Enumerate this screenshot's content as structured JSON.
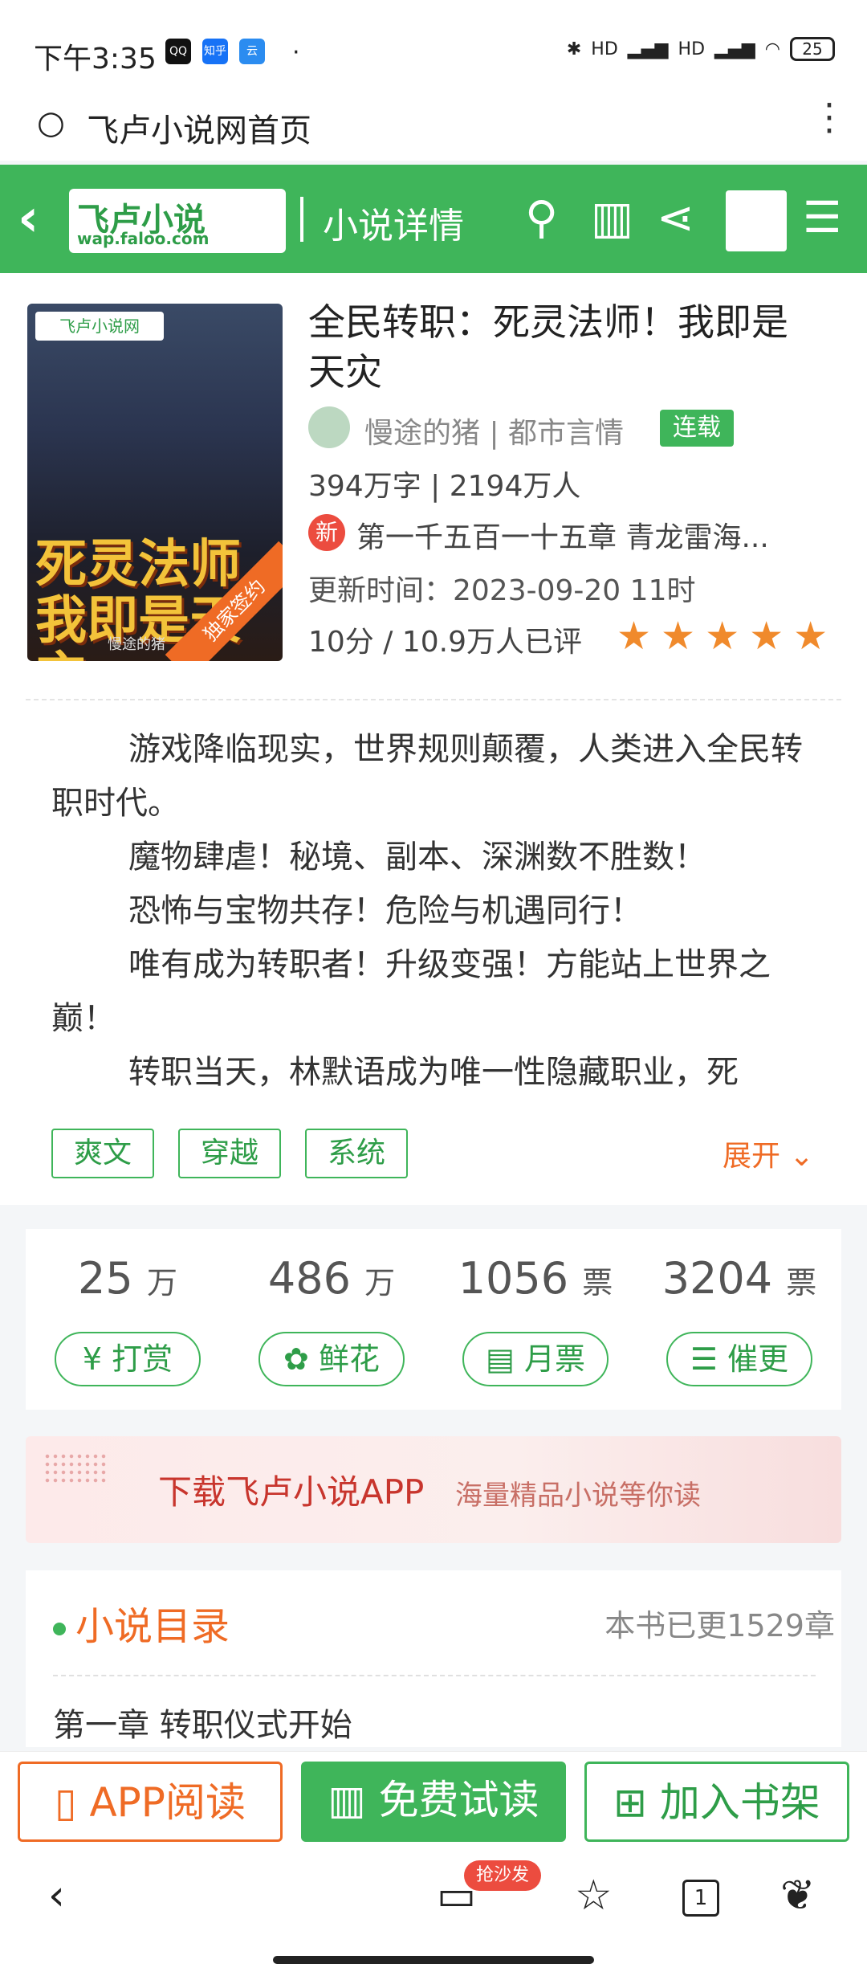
{
  "status": {
    "time": "下午3:35",
    "apps": [
      "QQ",
      "知乎",
      "云"
    ],
    "battery": "25",
    "signal_labels": [
      "HD",
      "HD"
    ]
  },
  "browser": {
    "url_title": "飞卢小说网首页"
  },
  "nav": {
    "logo_cn": "飞卢小说",
    "logo_url": "wap.faloo.com",
    "page_title": "小说详情"
  },
  "book": {
    "title": "全民转职：死灵法师！我即是天灾",
    "author": "慢途的猪",
    "category": "都市言情",
    "status_tag": "连载",
    "stats_line": "394万字 | 2194万人",
    "new_badge": "新",
    "latest_chapter": "第一千五百一十五章 青龙雷海...",
    "update_time": "更新时间：2023-09-20 11时",
    "rating": "10分 / 10.9万人已评",
    "stars": 5,
    "cover": {
      "site": "飞卢小说网",
      "big_text": "死灵法师 我即是天灾",
      "ribbon": "独家签约",
      "author": "慢途的猪"
    }
  },
  "description": [
    "游戏降临现实，世界规则颠覆，人类进入全民转职时代。",
    "魔物肆虐！秘境、副本、深渊数不胜数！",
    "恐怖与宝物共存！危险与机遇同行！",
    "唯有成为转职者！升级变强！方能站上世界之巅！",
    "转职当天，林默语成为唯一性隐藏职业，死"
  ],
  "tags": [
    "爽文",
    "穿越",
    "系统"
  ],
  "expand_label": "展开 ⌄",
  "stats": [
    {
      "num": "25",
      "unit": "万",
      "btn": "打赏"
    },
    {
      "num": "486",
      "unit": "万",
      "btn": "鲜花"
    },
    {
      "num": "1056",
      "unit": "票",
      "btn": "月票"
    },
    {
      "num": "3204",
      "unit": "票",
      "btn": "催更"
    }
  ],
  "banner": {
    "main": "下载飞卢小说APP",
    "sub": "海量精品小说等你读"
  },
  "catalog": {
    "title": "小说目录",
    "count": "本书已更1529章",
    "first_chapter": "第一章 转职仪式开始"
  },
  "bottom": {
    "app_read": "APP阅读",
    "free_read": "免费试读",
    "add_shelf": "加入书架"
  },
  "sysnav": {
    "sofa": "抢沙发",
    "tabs": "1"
  },
  "colors": {
    "green": "#3fb55a",
    "orange": "#ef6b25",
    "red": "#ec4c3f"
  }
}
